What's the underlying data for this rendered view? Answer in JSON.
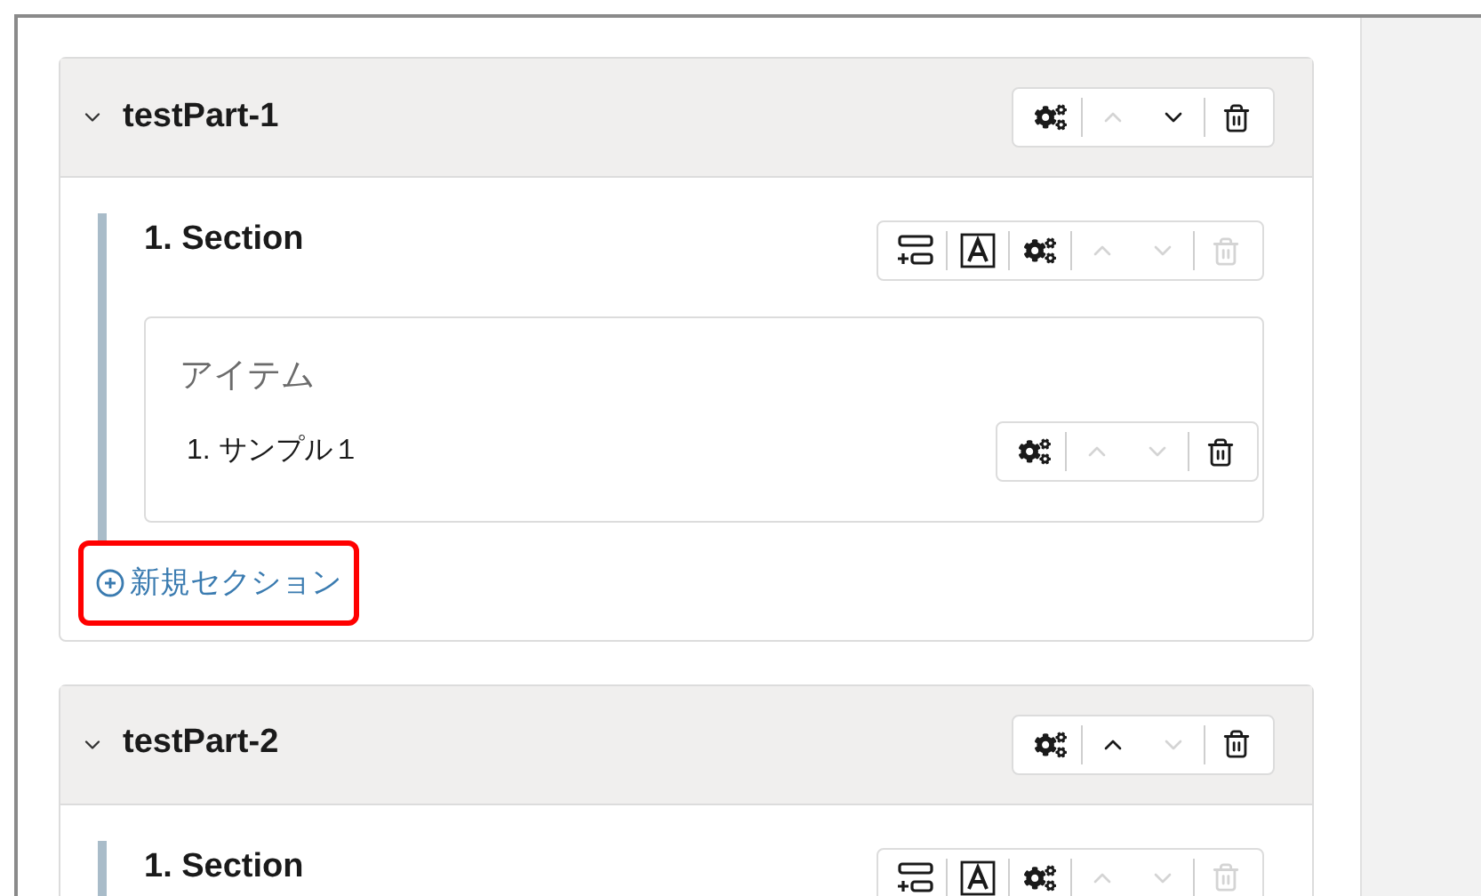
{
  "parts": [
    {
      "title": "testPart-1",
      "expanded": true,
      "toolbar": [
        {
          "kind": "settings",
          "disabled": false
        },
        {
          "kind": "up",
          "disabled": true
        },
        {
          "kind": "down",
          "disabled": false
        },
        {
          "kind": "delete",
          "disabled": false
        }
      ],
      "sections": [
        {
          "title": "1. Section",
          "toolbar": [
            {
              "kind": "add-row",
              "disabled": false
            },
            {
              "kind": "text",
              "disabled": false
            },
            {
              "kind": "settings",
              "disabled": false
            },
            {
              "kind": "up",
              "disabled": true
            },
            {
              "kind": "down",
              "disabled": true
            },
            {
              "kind": "delete",
              "disabled": true
            }
          ],
          "items_heading": "アイテム",
          "items": [
            {
              "label": "1. サンプル１",
              "toolbar": [
                {
                  "kind": "settings",
                  "disabled": false
                },
                {
                  "kind": "up",
                  "disabled": true
                },
                {
                  "kind": "down",
                  "disabled": true
                },
                {
                  "kind": "delete",
                  "disabled": false
                }
              ]
            }
          ]
        }
      ],
      "add_section": {
        "label": "新規セクション",
        "highlighted": true
      }
    },
    {
      "title": "testPart-2",
      "expanded": true,
      "toolbar": [
        {
          "kind": "settings",
          "disabled": false
        },
        {
          "kind": "up",
          "disabled": false
        },
        {
          "kind": "down",
          "disabled": true
        },
        {
          "kind": "delete",
          "disabled": false
        }
      ],
      "sections": [
        {
          "title": "1. Section",
          "toolbar": [
            {
              "kind": "add-row",
              "disabled": false
            },
            {
              "kind": "text",
              "disabled": false
            },
            {
              "kind": "settings",
              "disabled": false
            },
            {
              "kind": "up",
              "disabled": true
            },
            {
              "kind": "down",
              "disabled": true
            },
            {
              "kind": "delete",
              "disabled": true
            }
          ]
        }
      ]
    }
  ]
}
